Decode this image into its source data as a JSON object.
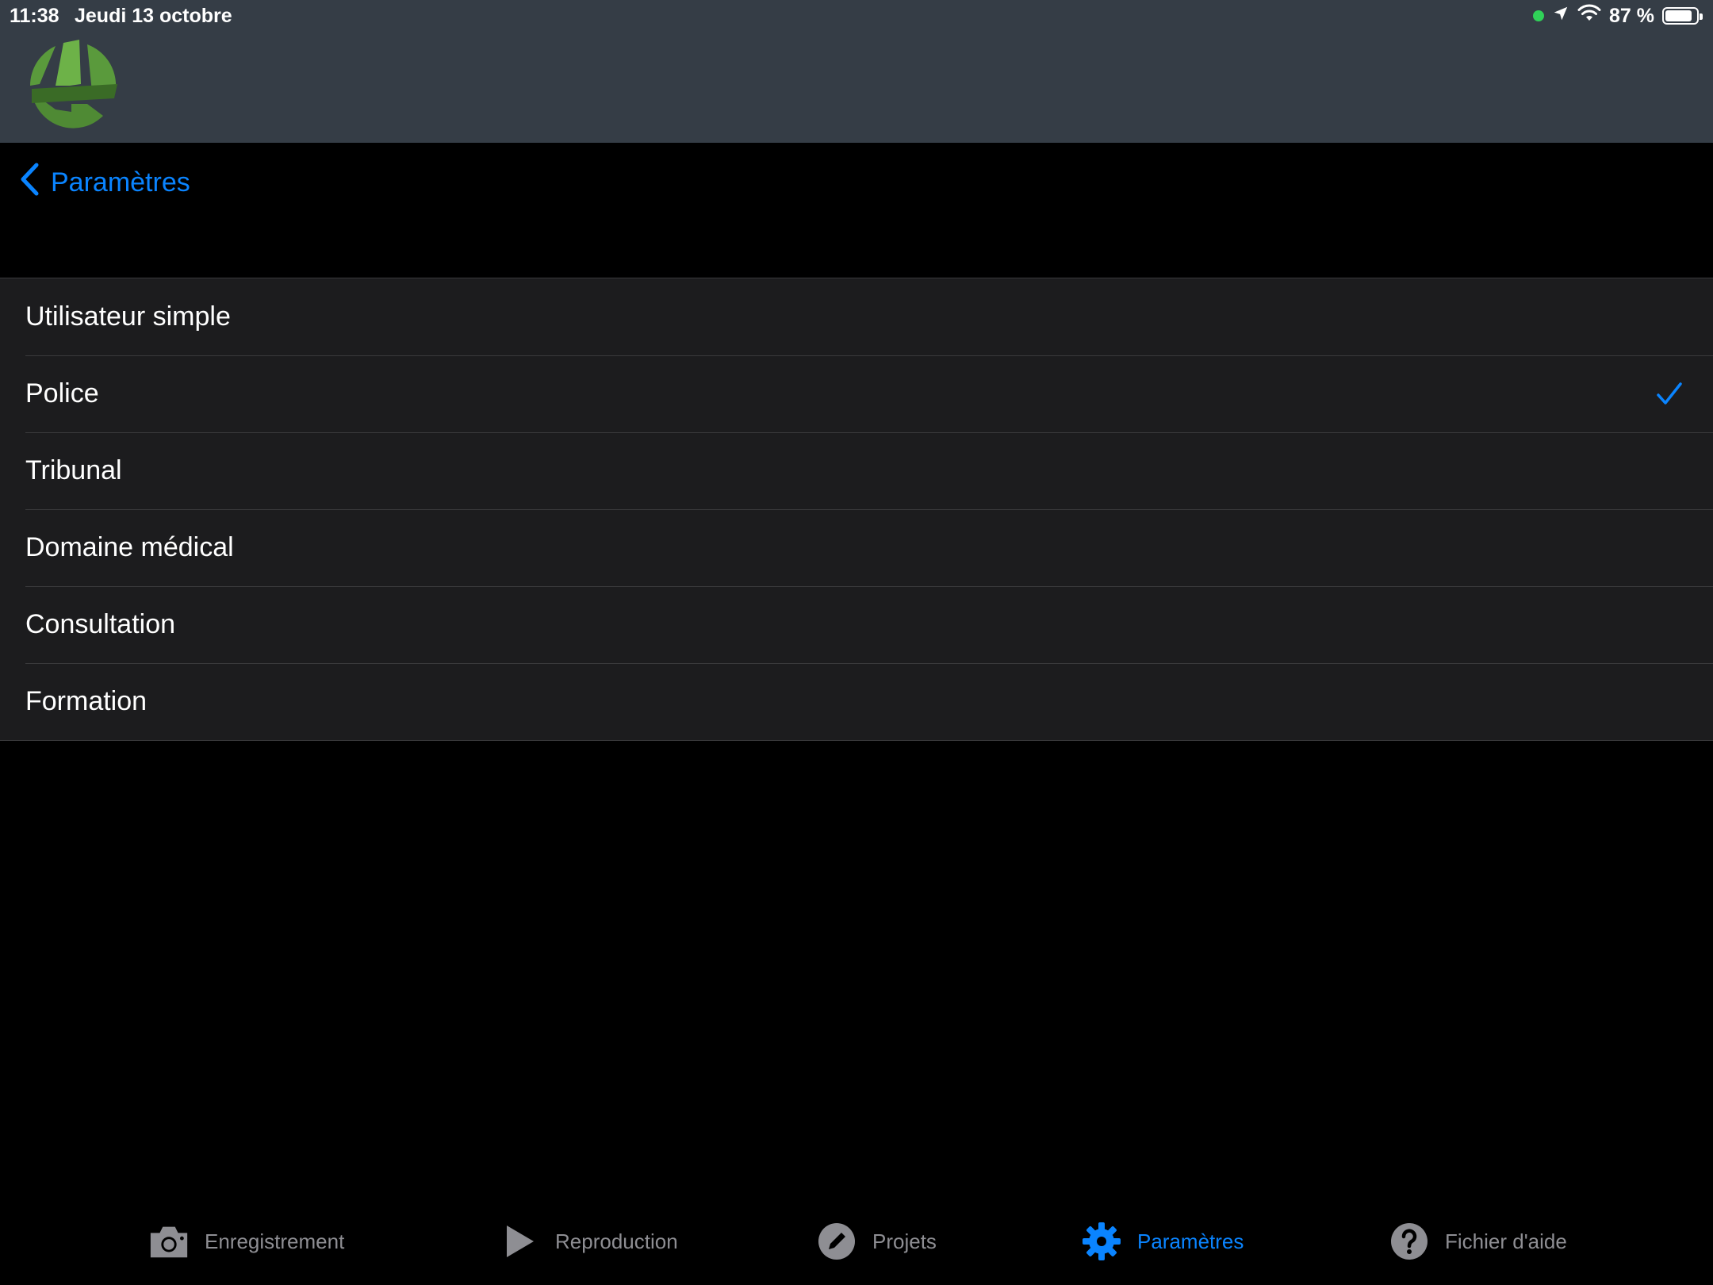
{
  "status_bar": {
    "time": "11:38",
    "date": "Jeudi 13 octobre",
    "battery_text": "87 %",
    "battery_level": 0.87
  },
  "nav": {
    "back_label": "Paramètres"
  },
  "list": {
    "items": [
      {
        "label": "Utilisateur simple",
        "selected": false
      },
      {
        "label": "Police",
        "selected": true
      },
      {
        "label": "Tribunal",
        "selected": false
      },
      {
        "label": "Domaine médical",
        "selected": false
      },
      {
        "label": "Consultation",
        "selected": false
      },
      {
        "label": "Formation",
        "selected": false
      }
    ]
  },
  "tabs": [
    {
      "label": "Enregistrement",
      "icon": "camera-icon",
      "active": false
    },
    {
      "label": "Reproduction",
      "icon": "play-icon",
      "active": false
    },
    {
      "label": "Projets",
      "icon": "pencil-icon",
      "active": false
    },
    {
      "label": "Paramètres",
      "icon": "gear-icon",
      "active": true
    },
    {
      "label": "Fichier d'aide",
      "icon": "question-icon",
      "active": false
    }
  ],
  "colors": {
    "header": "#353d46",
    "accent": "#0a84ff",
    "list_bg": "#1c1c1e",
    "inactive_tab": "#8e8e93",
    "logo_green": "#5a9a3c"
  }
}
